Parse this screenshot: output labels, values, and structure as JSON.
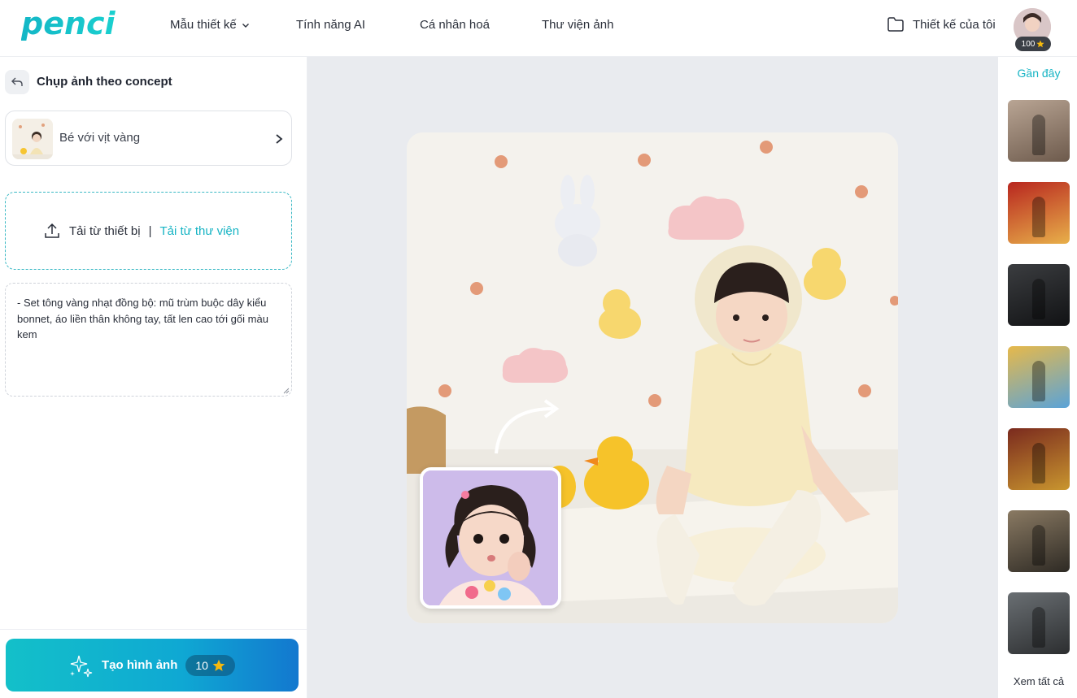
{
  "brand": {
    "logo_text": "penci",
    "color": "#16b4c4"
  },
  "nav": {
    "items": [
      {
        "label": "Mẫu thiết kế",
        "has_dropdown": true
      },
      {
        "label": "Tính năng AI"
      },
      {
        "label": "Cá nhân hoá"
      },
      {
        "label": "Thư viện ảnh"
      }
    ],
    "my_designs_label": "Thiết kế của tôi",
    "credits": "100"
  },
  "panel": {
    "title": "Chụp ảnh theo concept",
    "concept_label": "Bé với vịt vàng",
    "upload_device_label": "Tải từ thiết bị",
    "upload_separator": "|",
    "upload_library_label": "Tải từ thư viện",
    "prompt_text": "- Set tông vàng nhạt đồng bộ: mũ trùm buộc dây kiểu bonnet, áo liền thân không tay, tất len cao tới gối màu kem",
    "create_label": "Tạo hình ảnh",
    "create_cost": "10"
  },
  "recent": {
    "title": "Gần đây",
    "see_all_label": "Xem tất cả",
    "items": [
      {
        "name": "recent-1",
        "colors": [
          "#b9a594",
          "#6d5a4c"
        ]
      },
      {
        "name": "recent-2",
        "colors": [
          "#b8261f",
          "#e8b04a"
        ]
      },
      {
        "name": "recent-3",
        "colors": [
          "#3b3d40",
          "#111214"
        ]
      },
      {
        "name": "recent-4",
        "colors": [
          "#e7b94a",
          "#5aa3d8"
        ]
      },
      {
        "name": "recent-5",
        "colors": [
          "#7a2a1e",
          "#c9962f"
        ]
      },
      {
        "name": "recent-6",
        "colors": [
          "#8a7a63",
          "#2e2a24"
        ]
      },
      {
        "name": "recent-7",
        "colors": [
          "#6a6f73",
          "#2c2e30"
        ]
      }
    ]
  },
  "colors": {
    "accent": "#16b4c4",
    "button_gradient_start": "#13c0c9",
    "button_gradient_end": "#1378cf",
    "canvas_bg": "#e9ebef",
    "star": "#f5b90d"
  }
}
